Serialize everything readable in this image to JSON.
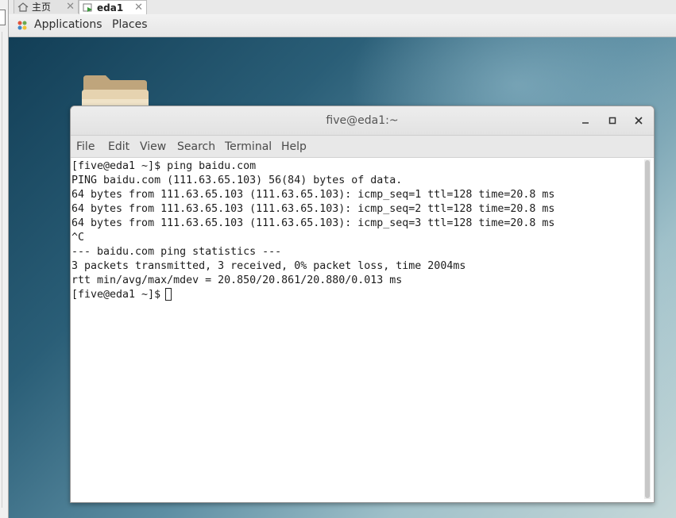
{
  "host_tabs": [
    {
      "label": "主页",
      "icon": "home-icon"
    },
    {
      "label": "eda1",
      "icon": "vm-icon"
    }
  ],
  "panel": {
    "applications_label": "Applications",
    "places_label": "Places"
  },
  "desktop": {
    "folder_icon": "folder-icon"
  },
  "terminal": {
    "title": "five@eda1:~",
    "menu": [
      "File",
      "Edit",
      "View",
      "Search",
      "Terminal",
      "Help"
    ],
    "lines": [
      "[five@eda1 ~]$ ping baidu.com",
      "PING baidu.com (111.63.65.103) 56(84) bytes of data.",
      "64 bytes from 111.63.65.103 (111.63.65.103): icmp_seq=1 ttl=128 time=20.8 ms",
      "64 bytes from 111.63.65.103 (111.63.65.103): icmp_seq=2 ttl=128 time=20.8 ms",
      "64 bytes from 111.63.65.103 (111.63.65.103): icmp_seq=3 ttl=128 time=20.8 ms",
      "^C",
      "--- baidu.com ping statistics ---",
      "3 packets transmitted, 3 received, 0% packet loss, time 2004ms",
      "rtt min/avg/max/mdev = 20.850/20.861/20.880/0.013 ms"
    ],
    "prompt": "[five@eda1 ~]$"
  }
}
